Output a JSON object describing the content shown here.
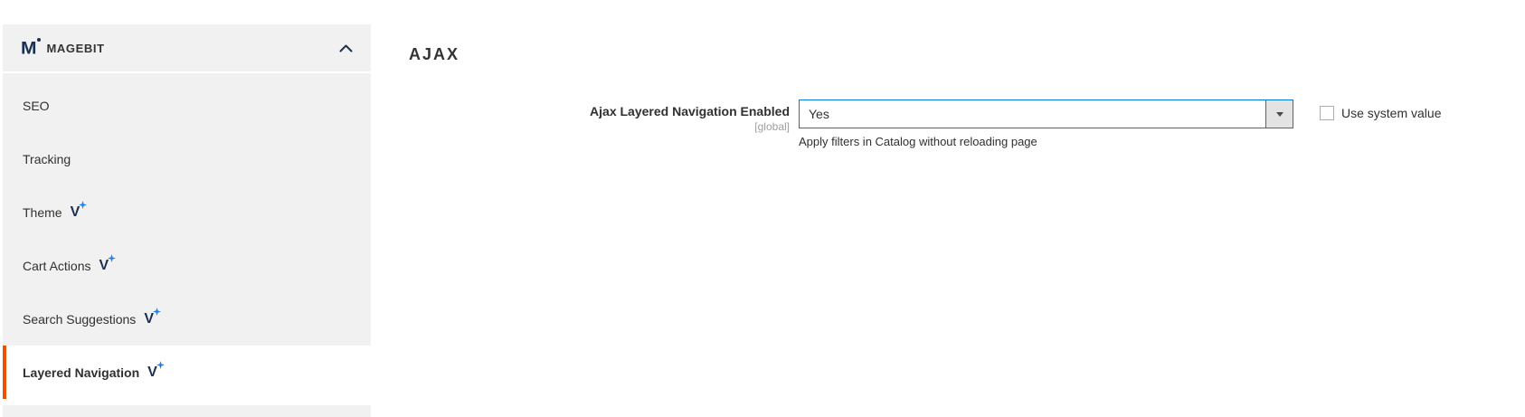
{
  "sidebar": {
    "section": {
      "logo": "M",
      "title": "MAGEBIT"
    },
    "pro_badge": "V",
    "items": [
      {
        "label": "SEO",
        "pro": false,
        "active": false
      },
      {
        "label": "Tracking",
        "pro": false,
        "active": false
      },
      {
        "label": "Theme",
        "pro": true,
        "active": false
      },
      {
        "label": "Cart Actions",
        "pro": true,
        "active": false
      },
      {
        "label": "Search Suggestions",
        "pro": true,
        "active": false
      },
      {
        "label": "Layered Navigation",
        "pro": true,
        "active": true
      }
    ]
  },
  "main": {
    "section_title": "AJAX",
    "field": {
      "label": "Ajax Layered Navigation Enabled",
      "scope": "[global]",
      "value": "Yes",
      "note": "Apply filters in Catalog without reloading page",
      "checkbox_label": "Use system value",
      "checkbox_checked": false
    }
  },
  "icons": {
    "section_collapse": "chevron-up-icon",
    "select_arrow": "caret-down-icon",
    "pro_sparkle": "sparkle-icon",
    "logo": "magebit-m-logo"
  },
  "colors": {
    "accent_orange": "#eb5202",
    "focus_blue": "#007bdb",
    "navy": "#1a2f52",
    "sparkle_blue": "#2680eb",
    "sidebar_bg": "#f1f1f1",
    "select_arrow_bg": "#e3e3e3",
    "text": "#303030",
    "scope_text": "#9e9e9e",
    "checkbox_border": "#adadad"
  }
}
